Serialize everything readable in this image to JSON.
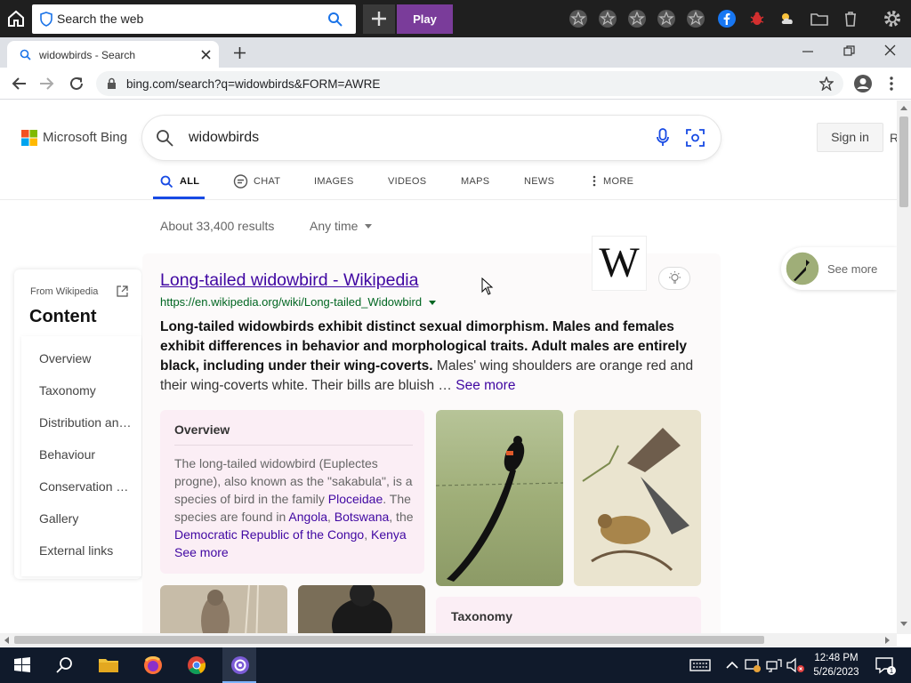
{
  "topbar": {
    "search_placeholder": "Search the web",
    "play_label": "Play"
  },
  "tab": {
    "title": "widowbirds - Search",
    "new_tab": "+"
  },
  "address": {
    "url": "bing.com/search?q=widowbirds&FORM=AWRE"
  },
  "bing": {
    "brand": "Microsoft Bing",
    "query": "widowbirds",
    "signin": "Sign in",
    "tabs": [
      "ALL",
      "CHAT",
      "IMAGES",
      "VIDEOS",
      "MAPS",
      "NEWS",
      "MORE"
    ],
    "results_count": "About 33,400 results",
    "any_time": "Any time"
  },
  "wiki_nav": {
    "from": "From Wikipedia",
    "heading": "Content",
    "items": [
      "Overview",
      "Taxonomy",
      "Distribution an…",
      "Behaviour",
      "Conservation …",
      "Gallery",
      "External links"
    ]
  },
  "result": {
    "title": "Long-tailed widowbird - Wikipedia",
    "url": "https://en.wikipedia.org/wiki/Long-tailed_Widowbird",
    "snippet_bold": "Long-tailed widowbirds exhibit distinct sexual dimorphism. Males and females exhibit differences in behavior and morphological traits. Adult males are entirely black, including under their wing-coverts.",
    "snippet_rest": " Males' wing shoulders are orange red and their wing-coverts white. Their bills are bluish … ",
    "see_more": "See more",
    "wiki_logo": "W"
  },
  "overview": {
    "heading": "Overview",
    "text1": "The long-tailed widowbird (Euplectes progne), also known as the \"sakabula\", is a species of bird in the family ",
    "link1": "Ploceidae",
    "text2": ". The species are found in ",
    "link2": "Angola",
    "text3": ", ",
    "link3": "Botswana",
    "text4": ", the ",
    "link4": "Democratic Republic of the Congo",
    "text5": ", ",
    "link5": "Kenya",
    "see_more": " See more"
  },
  "taxonomy": {
    "heading": "Taxonomy"
  },
  "side_chip": {
    "label": "See more"
  },
  "clock": {
    "time": "12:48 PM",
    "date": "5/26/2023"
  },
  "colors": {
    "link": "#4007a2",
    "url_green": "#006621",
    "accent": "#174ae4"
  }
}
